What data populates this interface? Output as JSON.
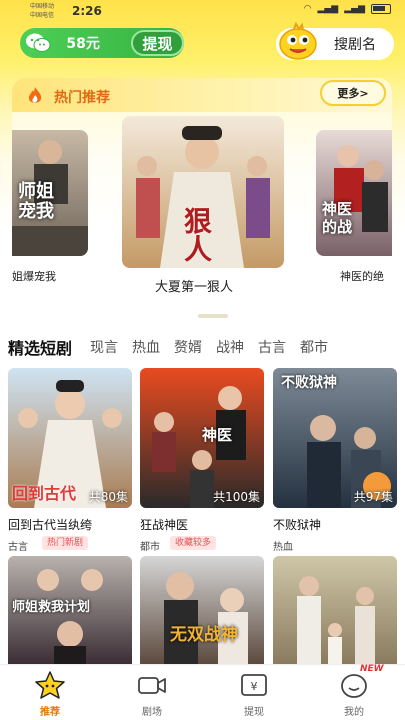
{
  "status": {
    "carrier1": "中国移动",
    "carrier2": "中国电信",
    "time": "2:26"
  },
  "wallet": {
    "amount": "58元",
    "withdraw_label": "提现"
  },
  "search": {
    "label": "搜剧名"
  },
  "hot": {
    "title": "热门推荐",
    "more_label": "更多>",
    "items": [
      {
        "label": "姐爆宠我",
        "poster_text": "师姐\n宠我"
      },
      {
        "label": "大夏第一狠人",
        "poster_text": "狠\n人"
      },
      {
        "label": "神医的绝",
        "poster_text": "神医\n的战"
      }
    ]
  },
  "tabs": [
    "精选短剧",
    "现言",
    "热血",
    "赘婿",
    "战神",
    "古言",
    "都市"
  ],
  "cards": [
    {
      "title": "回到古代当纨绔",
      "genre": "古言",
      "badge": "热门新剧",
      "episodes": "共80集",
      "poster_text": "回到古代"
    },
    {
      "title": "狂战神医",
      "genre": "都市",
      "badge": "收藏较多",
      "episodes": "共100集",
      "poster_text": "神医"
    },
    {
      "title": "不败狱神",
      "genre": "热血",
      "badge": "",
      "episodes": "共97集",
      "poster_text": "不败狱神"
    },
    {
      "poster_text": "师姐救我计划"
    },
    {
      "poster_text": "无双战神"
    },
    {
      "poster_text": ""
    }
  ],
  "nav": [
    {
      "label": "推荐",
      "icon": "star-icon",
      "active": true
    },
    {
      "label": "剧场",
      "icon": "video-camera-icon",
      "active": false
    },
    {
      "label": "提现",
      "icon": "wallet-icon",
      "active": false
    },
    {
      "label": "我的",
      "icon": "profile-icon",
      "active": false
    }
  ],
  "new_badge": "NEW",
  "colors": {
    "accent": "#ffe24a",
    "wallet_green": "#36b342",
    "hot_orange": "#e36a15",
    "badge_red": "#e05555",
    "nav_active": "#e07a00"
  }
}
